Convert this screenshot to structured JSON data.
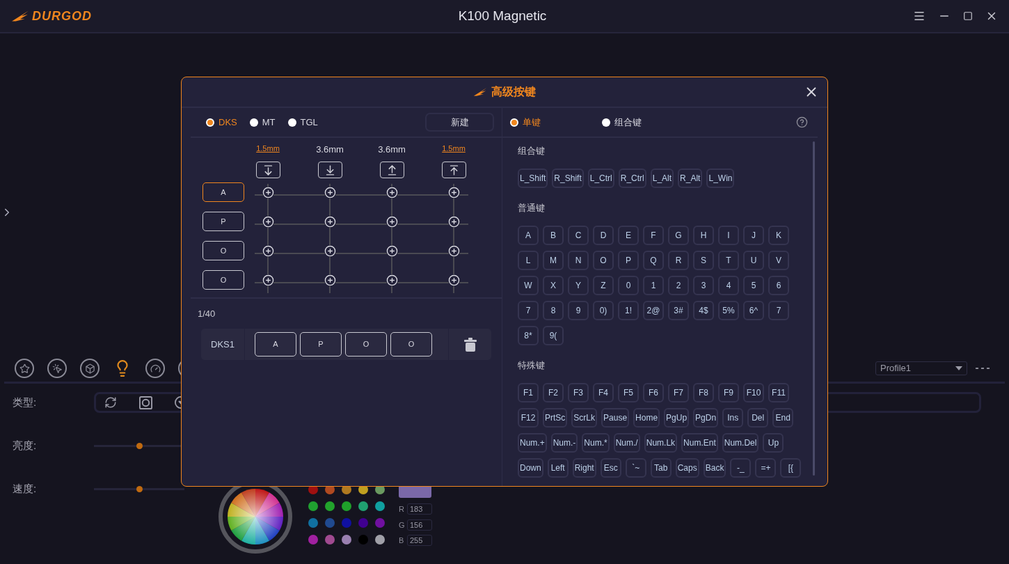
{
  "app": {
    "logo": "DURGOD",
    "title": "K100 Magnetic"
  },
  "toolbar": {
    "tabs": [
      {
        "selected": false
      },
      {
        "selected": false
      },
      {
        "selected": false
      },
      {
        "selected": true
      },
      {
        "selected": false
      },
      {
        "selected": false
      }
    ],
    "profile": "Profile1"
  },
  "settings": {
    "type_label": "类型:",
    "sliders": [
      {
        "label": "亮度:",
        "level": 0.5
      },
      {
        "label": "速度:",
        "level": 0.5
      }
    ],
    "swatches": [
      {
        "color": "#a01010"
      },
      {
        "color": "#b04a20"
      },
      {
        "color": "#b07a20"
      },
      {
        "color": "#c0a020"
      },
      {
        "color": "#6a9a60"
      },
      {
        "color": "#20a030"
      },
      {
        "color": "#22a32c"
      },
      {
        "color": "#1fa02a"
      },
      {
        "color": "#20a070"
      },
      {
        "color": "#10a0a0"
      },
      {
        "color": "#1070a0"
      },
      {
        "color": "#204a90"
      },
      {
        "color": "#1010a0"
      },
      {
        "color": "#400090"
      },
      {
        "color": "#7010a0"
      },
      {
        "color": "#a020a0"
      },
      {
        "color": "#a04a90"
      },
      {
        "color": "#9a80b0"
      },
      {
        "color": "#000000"
      },
      {
        "color": "#a0a0a8"
      }
    ],
    "rgb": [
      {
        "label": "R",
        "value": "183"
      },
      {
        "label": "G",
        "value": "156"
      },
      {
        "label": "B",
        "value": "255"
      }
    ]
  },
  "dialog": {
    "title": "高级按键",
    "modes": [
      {
        "label": "DKS",
        "selected": true
      },
      {
        "label": "MT",
        "selected": false
      },
      {
        "label": "TGL",
        "selected": false
      }
    ],
    "new_button": "新建",
    "distances": [
      {
        "label": "1.5mm",
        "highlighted": true
      },
      {
        "label": "3.6mm",
        "highlighted": false
      },
      {
        "label": "3.6mm",
        "highlighted": false
      },
      {
        "label": "1.5mm",
        "highlighted": true
      }
    ],
    "keys": [
      {
        "label": "A",
        "selected": true
      },
      {
        "label": "P",
        "selected": false
      },
      {
        "label": "O",
        "selected": false
      },
      {
        "label": "O",
        "selected": false
      }
    ],
    "counter": "1/40",
    "bindings": [
      {
        "name": "DKS1",
        "keys": [
          "A",
          "P",
          "O",
          "O"
        ]
      }
    ],
    "key_types": [
      {
        "label": "单键",
        "selected": true
      },
      {
        "label": "组合键",
        "selected": false
      }
    ],
    "sections": [
      {
        "title": "组合键",
        "keys": [
          "L_Shift",
          "R_Shift",
          "L_Ctrl",
          "R_Ctrl",
          "L_Alt",
          "R_Alt",
          "L_Win"
        ]
      },
      {
        "title": "普通键",
        "keys": [
          "A",
          "B",
          "C",
          "D",
          "E",
          "F",
          "G",
          "H",
          "I",
          "J",
          "K",
          "L",
          "M",
          "N",
          "O",
          "P",
          "Q",
          "R",
          "S",
          "T",
          "U",
          "V",
          "W",
          "X",
          "Y",
          "Z",
          "0",
          "1",
          "2",
          "3",
          "4",
          "5",
          "6",
          "7",
          "8",
          "9",
          "0)",
          "1!",
          "2@",
          "3#",
          "4$",
          "5%",
          "6^",
          "7",
          "8*",
          "9("
        ]
      },
      {
        "title": "特殊键",
        "keys": [
          "F1",
          "F2",
          "F3",
          "F4",
          "F5",
          "F6",
          "F7",
          "F8",
          "F9",
          "F10",
          "F11",
          "F12",
          "PrtSc",
          "ScrLk",
          "Pause",
          "Home",
          "PgUp",
          "PgDn",
          "Ins",
          "Del",
          "End",
          "Num.+",
          "Num.-",
          "Num.*",
          "Num./",
          "Num.Lk",
          "Num.Ent",
          "Num.Del",
          "Up",
          "Down",
          "Left",
          "Right",
          "Esc",
          "`~",
          "Tab",
          "Caps",
          "Back",
          "-_",
          "=+",
          "[{"
        ]
      }
    ]
  }
}
